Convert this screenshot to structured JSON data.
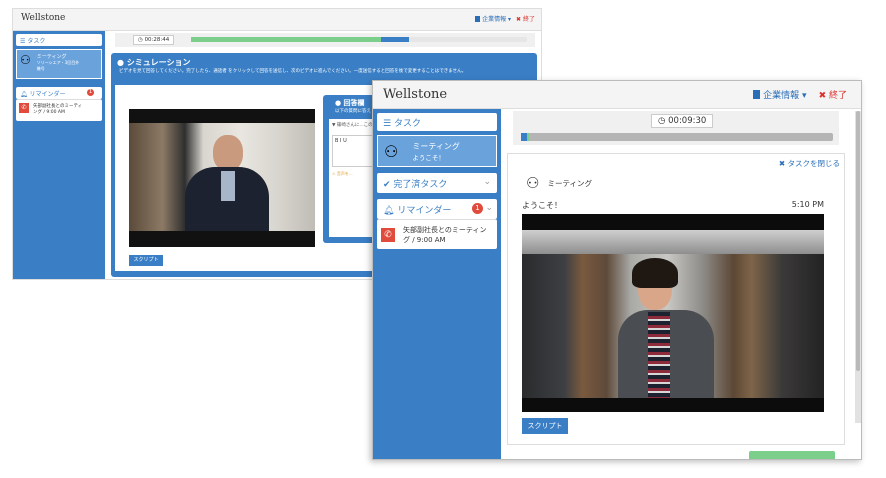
{
  "brand": "Wellstone",
  "menu": {
    "company": "企業情報 ▾",
    "end": "終了"
  },
  "back": {
    "timer": "00:28:44",
    "sidebar": {
      "task_header": "タスク",
      "task_title": "ミーティング",
      "task_sub": "ソリーシエア・3回目外機号",
      "reminder_header": "リマインダー",
      "reminder_count": "1",
      "reminder_text": "矢部副社長とのミーティング / 9:00 AM"
    },
    "sim_title": "シミュレーション",
    "sim_desc": "ビデオを見て回答してください。完了したら、通話者 をクリックして回答を送信し、次のビデオに進んでください。一度送信すると回答を後で変更することはできません。",
    "answer_title": "回答欄",
    "answer_sub": "以下の質問に答え",
    "answer_q": "▼ 篠崎さんに...このように言い...",
    "answer_fmt": "B  I  U",
    "answer_hint": "⚠ 音声を...",
    "script_btn": "スクリプト"
  },
  "front": {
    "timer": "00:09:30",
    "progress": {
      "done_fraction": 0.02
    },
    "sidebar": {
      "task_header": "タスク",
      "task_title": "ミーティング",
      "task_sub": "ようこそ！",
      "done_header": "完了済タスク",
      "reminder_header": "リマインダー",
      "reminder_count": "1",
      "reminder_text": "矢部副社長とのミーティング / 9:00 AM"
    },
    "close_task": "タスクを閉じる",
    "meeting_label": "ミーティング",
    "welcome": "ようこそ！",
    "time": "5:10 PM",
    "script_btn": "スクリプト"
  },
  "colors": {
    "accent": "#3a7fc6",
    "end": "#d9322b",
    "progress_done": "#7ccf8a",
    "progress_current": "#3a7fc6"
  },
  "icons": [
    "people-icon",
    "bell-icon",
    "phone-icon",
    "clock-icon",
    "check-icon",
    "close-x-icon",
    "chevron-down-icon",
    "building-icon",
    "comment-icon"
  ]
}
